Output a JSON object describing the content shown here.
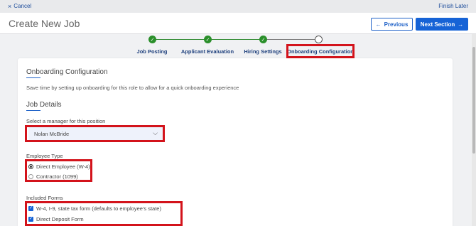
{
  "topbar": {
    "cancel_label": "Cancel",
    "finish_later_label": "Finish Later"
  },
  "header": {
    "title": "Create New Job",
    "previous_label": "Previous",
    "next_label": "Next Section"
  },
  "steps": [
    {
      "label": "Job Posting",
      "status": "complete"
    },
    {
      "label": "Applicant Evaluation",
      "status": "complete"
    },
    {
      "label": "Hiring Settings",
      "status": "complete"
    },
    {
      "label": "Onboarding Configuration",
      "status": "current"
    }
  ],
  "card": {
    "heading": "Onboarding Configuration",
    "description": "Save time by setting up onboarding for this role to allow for a quick onboarding experience",
    "job_details_heading": "Job Details",
    "manager_label": "Select a manager for this position",
    "manager_value": "Nolan McBride",
    "employee_type_label": "Employee Type",
    "employee_types": [
      {
        "label": "Direct Employee (W-4)",
        "selected": true
      },
      {
        "label": "Contractor (1099)",
        "selected": false
      }
    ],
    "included_forms_label": "Included Forms",
    "forms": [
      {
        "label": "W-4, I-9, state tax form (defaults to employee's state)",
        "checked": true
      },
      {
        "label": "Direct Deposit Form",
        "checked": true
      }
    ]
  },
  "colors": {
    "accent": "#1663d6",
    "success": "#2a8f2a",
    "highlight": "#d3131b",
    "nav_text": "#1d3f7c"
  }
}
